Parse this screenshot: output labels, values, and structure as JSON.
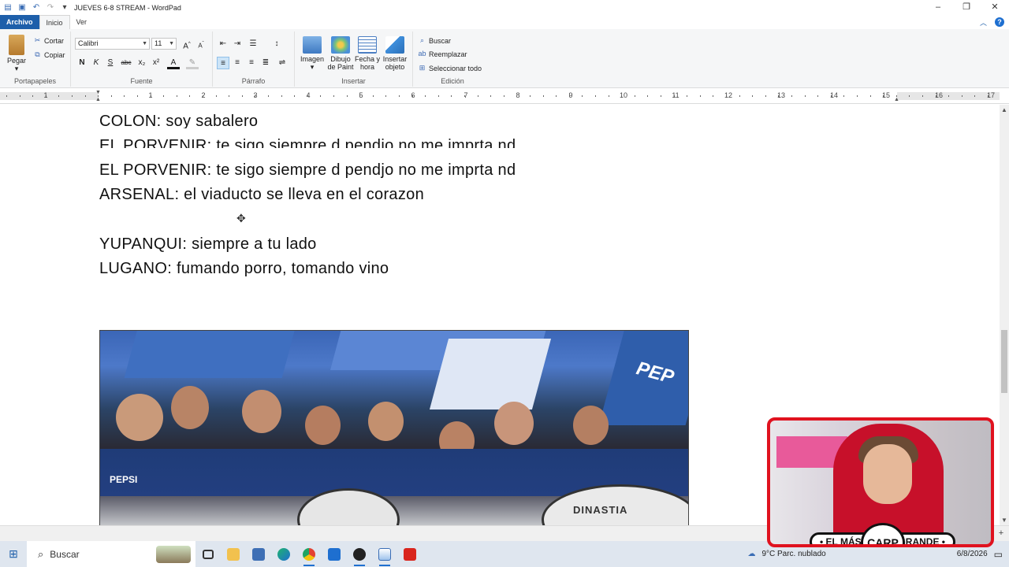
{
  "window": {
    "title": "JUEVES 6-8 STREAM - WordPad"
  },
  "tabs": [
    {
      "label": "Archivo"
    },
    {
      "label": "Inicio"
    },
    {
      "label": "Ver"
    }
  ],
  "ribbon": {
    "clipboard": {
      "paste": "Pegar",
      "cut": "Cortar",
      "copy": "Copiar",
      "label": "Portapapeles"
    },
    "font": {
      "family": "Calibri",
      "size": "11",
      "label": "Fuente",
      "bold": "N",
      "italic": "K",
      "underline": "S",
      "strike": "abc",
      "sub": "x₂",
      "sup": "x²"
    },
    "paragraph": {
      "label": "Párrafo"
    },
    "insert": {
      "image": "Imagen",
      "paint": "Dibujo de Paint",
      "datetime": "Fecha y hora",
      "object": "Insertar objeto",
      "label": "Insertar"
    },
    "edit": {
      "find": "Buscar",
      "replace": "Reemplazar",
      "selectall": "Seleccionar todo",
      "label": "Edición"
    }
  },
  "ruler": {
    "numbers": [
      "1",
      "1",
      "2",
      "3",
      "4",
      "5",
      "6",
      "7",
      "8",
      "9",
      "10",
      "11",
      "12",
      "13",
      "14",
      "15",
      "16",
      "17"
    ]
  },
  "document": {
    "lines": [
      "COLON: soy sabalero",
      "EL PORVENIR: te sigo siempre  d pendjo  no me imprta  nd",
      "EL PORVENIR: te sigo siempre  d pendjo  no me imprta  nd",
      "ARSENAL: el viaducto  se lleva  en el corazon",
      "YUPANQUI: siempre  a tu lado",
      "LUGANO: fumando  porro,  tomando vino"
    ],
    "photo_text": {
      "flag": "PEP",
      "drum": "DINASTIA",
      "shirt": "PEPSI"
    }
  },
  "taskbar": {
    "search_label": "Buscar",
    "weather": "9°C  Parc. nublado",
    "date": "6/8/2026"
  },
  "webcam": {
    "left_text": "• EL MÁS",
    "right_text": "GRANDE •",
    "crest": "CARP"
  }
}
